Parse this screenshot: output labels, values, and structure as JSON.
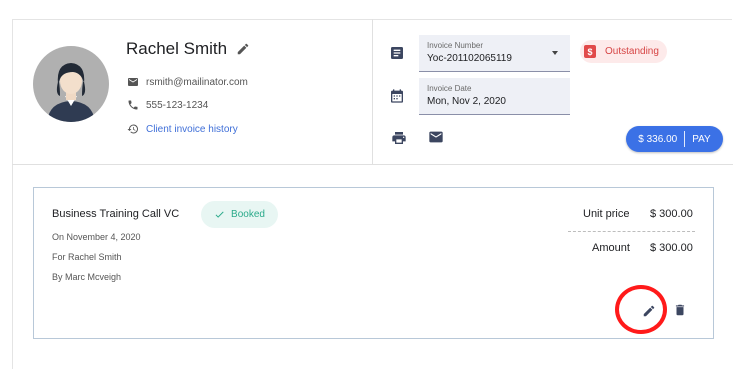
{
  "client": {
    "name": "Rachel Smith",
    "email": "rsmith@mailinator.com",
    "phone": "555-123-1234",
    "history_link": "Client invoice history"
  },
  "invoice": {
    "number_label": "Invoice Number",
    "number_value": "Yoc-201102065119",
    "date_label": "Invoice Date",
    "date_value": "Mon, Nov 2, 2020",
    "status": "Outstanding",
    "pay_amount": "$ 336.00",
    "pay_label": "PAY"
  },
  "item": {
    "service": "Business Training Call VC",
    "status": "Booked",
    "date": "On November 4, 2020",
    "for": "For Rachel Smith",
    "by": "By Marc Mcveigh",
    "unit_price_label": "Unit price",
    "unit_price_value": "$ 300.00",
    "amount_label": "Amount",
    "amount_value": "$ 300.00"
  },
  "colors": {
    "accent": "#3b71e6",
    "status_outstanding": "#d64545",
    "status_booked": "#2aaa8a",
    "highlight": "#ff1a1a"
  }
}
